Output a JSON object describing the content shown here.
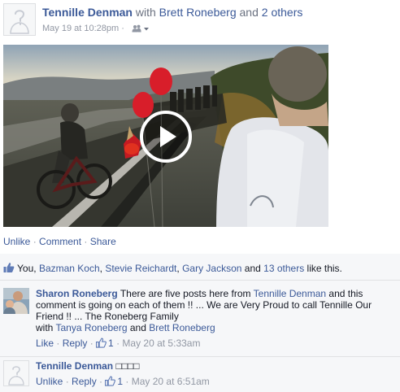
{
  "post": {
    "author": "Tennille Denman",
    "with_word": "with",
    "tagged": "Brett Roneberg",
    "and_word": "and",
    "others": "2 others",
    "timestamp": "May 19 at 10:28pm",
    "dot": "·"
  },
  "actions": {
    "unlike": "Unlike",
    "comment": "Comment",
    "share": "Share",
    "sep": " · "
  },
  "likes": {
    "prefix": "You,",
    "names": [
      "Bazman Koch",
      "Stevie Reichardt",
      "Gary Jackson"
    ],
    "and_word": "and",
    "others": "13 others",
    "suffix": "like this."
  },
  "comments": [
    {
      "author": "Sharon Roneberg",
      "text_1": "There are five posts here from",
      "mention": "Tennille Denman",
      "text_2": "and this comment is going on each of them !! ... We are Very Proud to call Tennille Our Friend !! ... The Roneberg Family",
      "with_word": "with",
      "tag_1": "Tanya Roneberg",
      "and_word": "and",
      "tag_2": "Brett Roneberg",
      "action_1": "Like",
      "action_2": "Reply",
      "like_count": "1",
      "time": "May 20 at 5:33am"
    },
    {
      "author": "Tennille Denman",
      "text": "□□□□",
      "action_1": "Unlike",
      "action_2": "Reply",
      "like_count": "1",
      "time": "May 20 at 6:51am"
    }
  ],
  "colors": {
    "link": "#3b5998",
    "muted": "#9197a3",
    "ufi_bg": "#f6f7f9"
  },
  "icons": {
    "audience": "friends-icon",
    "dropdown": "chevron-down-icon",
    "like": "thumbs-up-icon",
    "play": "play-icon"
  }
}
